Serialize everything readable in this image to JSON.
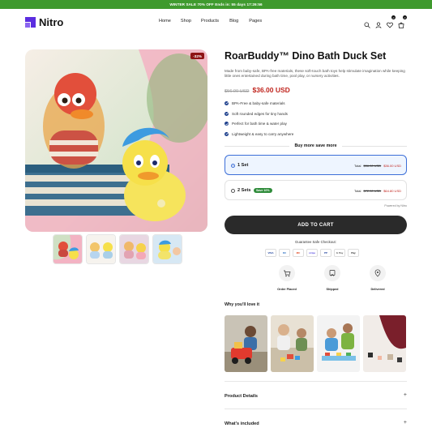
{
  "promo": {
    "text": "WINTER SALE 70% OFF Ends in: 55 days 17:26:56"
  },
  "brand": {
    "name": "Nitro",
    "color": "#5b2de0"
  },
  "nav": {
    "items": [
      "Home",
      "Shop",
      "Products",
      "Blog",
      "Pages"
    ]
  },
  "header_icons": {
    "wishlist_count": "0",
    "cart_count": "0"
  },
  "gallery": {
    "discount_badge": "-32%"
  },
  "product": {
    "title": "RoarBuddy™ Dino Bath Duck Set",
    "description": "Made from baby-safe, BPA-free materials, these soft-touch bath toys help stimulate imagination while keeping little ones entertained during bath time, pool play, or nursery activities.",
    "old_price": "$56.00 USD",
    "new_price": "$36.00 USD",
    "features": [
      "BPA-Free & baby-safe materials",
      "Soft rounded edges for tiny hands",
      "Perfect for bath time & water play",
      "Lightweight & easy to carry anywhere"
    ]
  },
  "bundle": {
    "heading": "Buy more save more",
    "options": [
      {
        "label": "1 Set",
        "total_label": "Total",
        "old": "$36.00 USD",
        "new": "$36.00 USD",
        "selected": true
      },
      {
        "label": "2 Sets",
        "badge": "Save 10%",
        "total_label": "Total",
        "old": "$72.00 USD",
        "new": "$64.80 USD",
        "selected": false
      }
    ],
    "powered_by": "Powered by Nitro"
  },
  "cart": {
    "button": "ADD TO CART"
  },
  "checkout": {
    "heading": "Guarantee Safe Checkout:",
    "payments": [
      "VISA",
      "DC",
      "MC",
      "stripe",
      "PP",
      "G Pay",
      "Pay"
    ]
  },
  "steps": [
    "Order Placed",
    "Shipped",
    "Delivered"
  ],
  "why": {
    "heading": "Why you'll love it"
  },
  "accordions": [
    "Product Details",
    "What's included"
  ],
  "colors": {
    "promo_bg": "#3f9a2e",
    "price_red": "#c0241d",
    "button_dark": "#2a2a2a",
    "select_blue": "#3c6fd8"
  }
}
